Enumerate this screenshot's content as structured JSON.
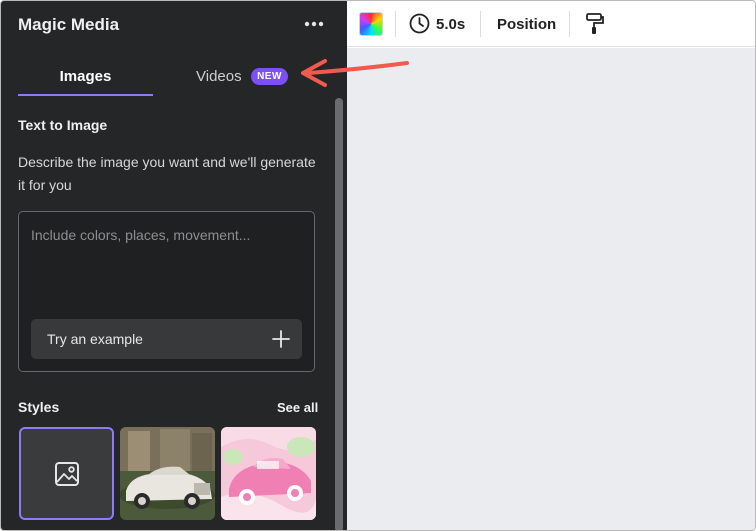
{
  "panel": {
    "title": "Magic Media",
    "tabs": [
      {
        "label": "Images",
        "active": true
      },
      {
        "label": "Videos",
        "badge": "NEW"
      }
    ],
    "section_heading": "Text to Image",
    "description": "Describe the image you want and we'll generate it for you",
    "prompt": {
      "value": "",
      "placeholder": "Include colors, places, movement..."
    },
    "try_example_label": "Try an example",
    "styles": {
      "label": "Styles",
      "see_all_label": "See all",
      "tiles": [
        {
          "icon": "image-icon",
          "selected": true
        },
        {
          "icon": "vintage-car-photo"
        },
        {
          "icon": "pink-car-illustration"
        }
      ]
    }
  },
  "toolbar": {
    "duration": "5.0s",
    "position_label": "Position"
  },
  "colors": {
    "panel_bg": "#252627",
    "accent": "#8b7cf6",
    "badge": "#7d4ff7",
    "arrow": "#f05a4f",
    "canvas": "#ebecf0"
  }
}
